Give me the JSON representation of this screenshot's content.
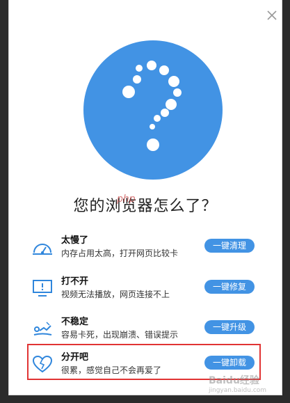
{
  "dialog": {
    "title": "您的浏览器怎么了？"
  },
  "items": [
    {
      "name": "太慢了",
      "desc": "内存占用太高，打开网页比较卡",
      "button": "一键清理",
      "icon": "speedometer-icon"
    },
    {
      "name": "打不开",
      "desc": "视频无法播放，网页连接不上",
      "button": "一键修复",
      "icon": "monitor-alert-icon"
    },
    {
      "name": "不稳定",
      "desc": "容易卡死，出现崩溃、错误提示",
      "button": "一键升级",
      "icon": "broken-chart-icon"
    },
    {
      "name": "分开吧",
      "desc": "很累，感觉自己不会再爱了",
      "button": "一键卸载",
      "icon": "broken-heart-icon"
    }
  ],
  "watermark": {
    "php": "php",
    "site": "Baidu经验",
    "url": "jingyan.baidu.com"
  },
  "colors": {
    "accent": "#4293e4",
    "highlight_border": "#e13434",
    "background": "#2b2b2b"
  }
}
